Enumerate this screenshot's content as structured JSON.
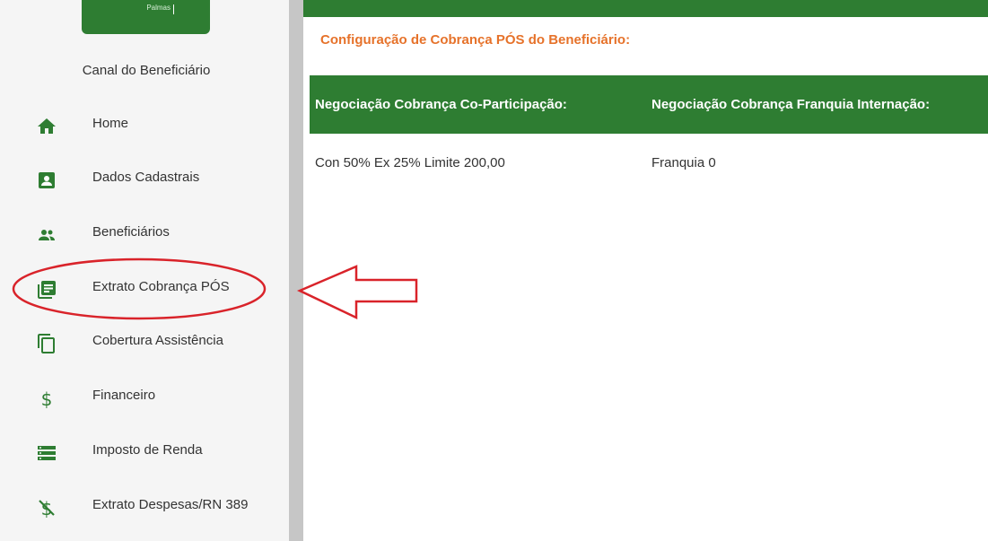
{
  "logo": {
    "text": "Palmas"
  },
  "sidebar": {
    "title": "Canal do Beneficiário",
    "items": [
      {
        "label": "Home",
        "icon": "home-icon"
      },
      {
        "label": "Dados Cadastrais",
        "icon": "id-card-icon"
      },
      {
        "label": "Beneficiários",
        "icon": "people-icon"
      },
      {
        "label": "Extrato Cobrança PÓS",
        "icon": "document-list-icon"
      },
      {
        "label": "Cobertura Assistência",
        "icon": "copy-icon"
      },
      {
        "label": "Financeiro",
        "icon": "dollar-icon"
      },
      {
        "label": "Imposto de Renda",
        "icon": "storage-icon"
      },
      {
        "label": "Extrato Despesas/RN 389",
        "icon": "money-off-icon"
      }
    ]
  },
  "main": {
    "section_title": "Configuração de Cobrança PÓS do Beneficiário:",
    "table": {
      "headers": [
        "Negociação Cobrança Co-Participação:",
        "Negociação Cobrança Franquia Internação:"
      ],
      "rows": [
        [
          "Con 50% Ex 25% Limite 200,00",
          "Franquia 0"
        ]
      ]
    }
  },
  "colors": {
    "brand_green": "#2e7d32",
    "title_orange": "#e6722a",
    "annotation_red": "#d9232a"
  }
}
